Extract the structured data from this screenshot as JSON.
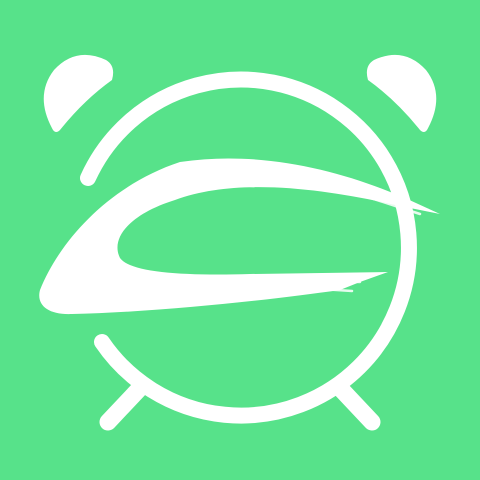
{
  "app_icon": {
    "icon_name": "alarm-clock-icon",
    "background_color": "#57e28a",
    "foreground_color": "#ffffff"
  }
}
